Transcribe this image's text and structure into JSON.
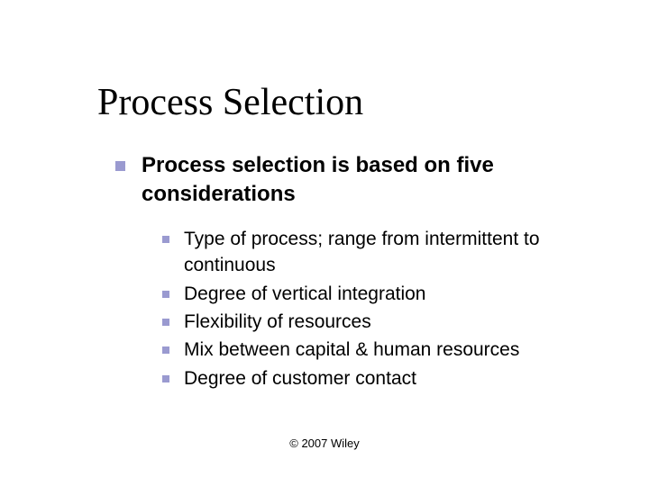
{
  "title": "Process Selection",
  "main_point": "Process selection is based on five considerations",
  "sub_points": [
    "Type of process; range from intermittent to continuous",
    "Degree of vertical integration",
    "Flexibility of resources",
    "Mix between capital & human resources",
    "Degree of customer contact"
  ],
  "footer": "© 2007 Wiley"
}
